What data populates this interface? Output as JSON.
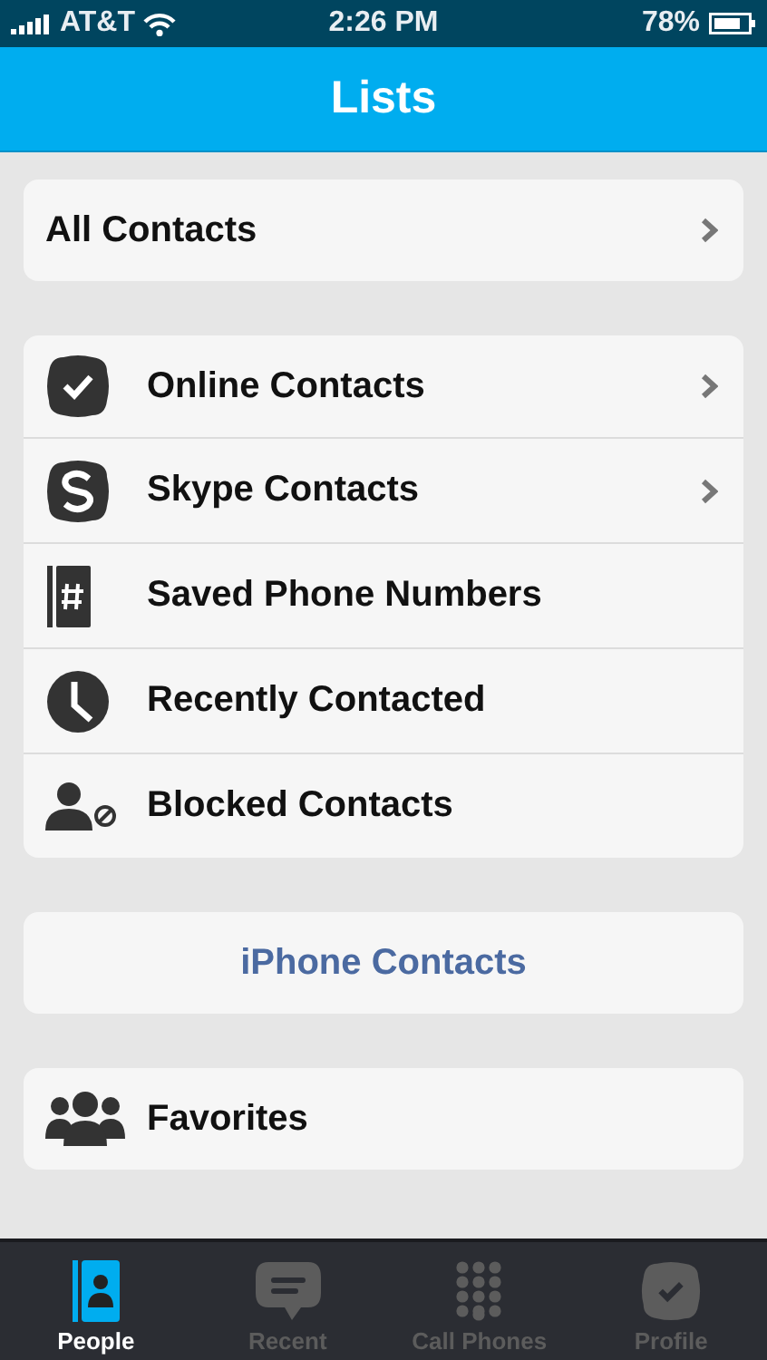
{
  "status_bar": {
    "carrier": "AT&T",
    "time": "2:26 PM",
    "battery": "78%"
  },
  "header": {
    "title": "Lists"
  },
  "groups": [
    {
      "items": [
        {
          "kind": "plain",
          "label": "All Contacts",
          "chevron": true
        }
      ]
    },
    {
      "items": [
        {
          "kind": "icon",
          "label": "Online Contacts",
          "chevron": true
        },
        {
          "kind": "icon",
          "label": "Skype Contacts",
          "chevron": true
        },
        {
          "kind": "icon",
          "label": "Saved Phone Numbers",
          "chevron": false
        },
        {
          "kind": "icon",
          "label": "Recently Contacted",
          "chevron": false
        },
        {
          "kind": "icon",
          "label": "Blocked Contacts",
          "chevron": false
        }
      ]
    },
    {
      "items": [
        {
          "kind": "link",
          "label": "iPhone Contacts"
        }
      ]
    },
    {
      "items": [
        {
          "kind": "icon",
          "label": "Favorites",
          "chevron": false
        }
      ]
    }
  ],
  "tabs": [
    {
      "label": "People",
      "selected": true
    },
    {
      "label": "Recent",
      "selected": false
    },
    {
      "label": "Call Phones",
      "selected": false
    },
    {
      "label": "Profile",
      "selected": false
    }
  ]
}
